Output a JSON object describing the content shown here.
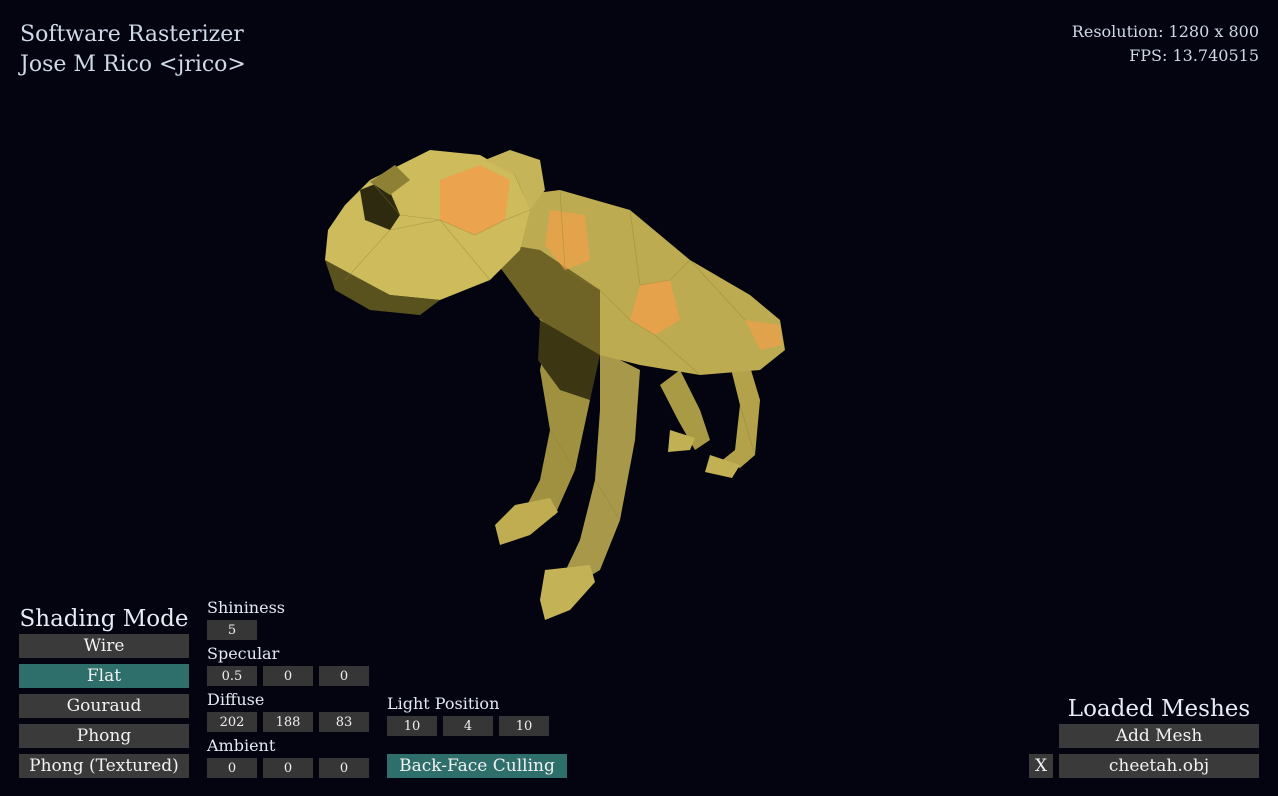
{
  "header": {
    "app_title": "Software Rasterizer",
    "author": "Jose M Rico <jrico>",
    "resolution": "Resolution: 1280 x 800",
    "fps": "FPS: 13.740515"
  },
  "shading": {
    "title": "Shading Mode",
    "modes": [
      "Wire",
      "Flat",
      "Gouraud",
      "Phong",
      "Phong (Textured)"
    ],
    "selected": "Flat"
  },
  "material": {
    "shininess_label": "Shininess",
    "shininess": "5",
    "specular_label": "Specular",
    "specular": [
      "0.5",
      "0",
      "0"
    ],
    "diffuse_label": "Diffuse",
    "diffuse": [
      "202",
      "188",
      "83"
    ],
    "ambient_label": "Ambient",
    "ambient": [
      "0",
      "0",
      "0"
    ]
  },
  "light": {
    "label": "Light Position",
    "position": [
      "10",
      "4",
      "10"
    ],
    "culling_label": "Back-Face Culling",
    "culling_enabled": true
  },
  "meshes": {
    "title": "Loaded Meshes",
    "add_label": "Add Mesh",
    "remove_label": "X",
    "items": [
      "cheetah.obj"
    ]
  },
  "colors": {
    "background": "#03040f",
    "button": "#3a3a3a",
    "active": "#2e6e6b",
    "mesh_light": "#c8b85a",
    "mesh_highlight": "#f0a04a",
    "mesh_shadow": "#2e2a10"
  }
}
